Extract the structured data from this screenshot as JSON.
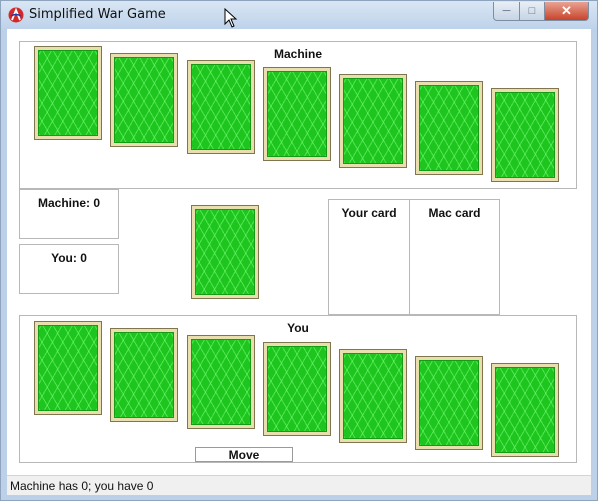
{
  "window": {
    "title": "Simplified War Game",
    "icon": "app-logo-icon",
    "minimize_icon": "minimize-icon",
    "maximize_icon": "maximize-icon",
    "close_icon": "close-icon"
  },
  "machine_panel": {
    "title": "Machine",
    "card_count": 7
  },
  "scores": {
    "machine": "Machine: 0",
    "you": "You: 0"
  },
  "battle": {
    "your_card_label": "Your card",
    "mac_card_label": "Mac card"
  },
  "player_panel": {
    "title": "You",
    "card_count": 7
  },
  "move_button": {
    "label": "Move"
  },
  "status": {
    "text": "Machine has 0; you have 0"
  },
  "colors": {
    "card_green": "#1ec51e",
    "card_border": "#e9dfae",
    "close_red": "#c8442b"
  }
}
